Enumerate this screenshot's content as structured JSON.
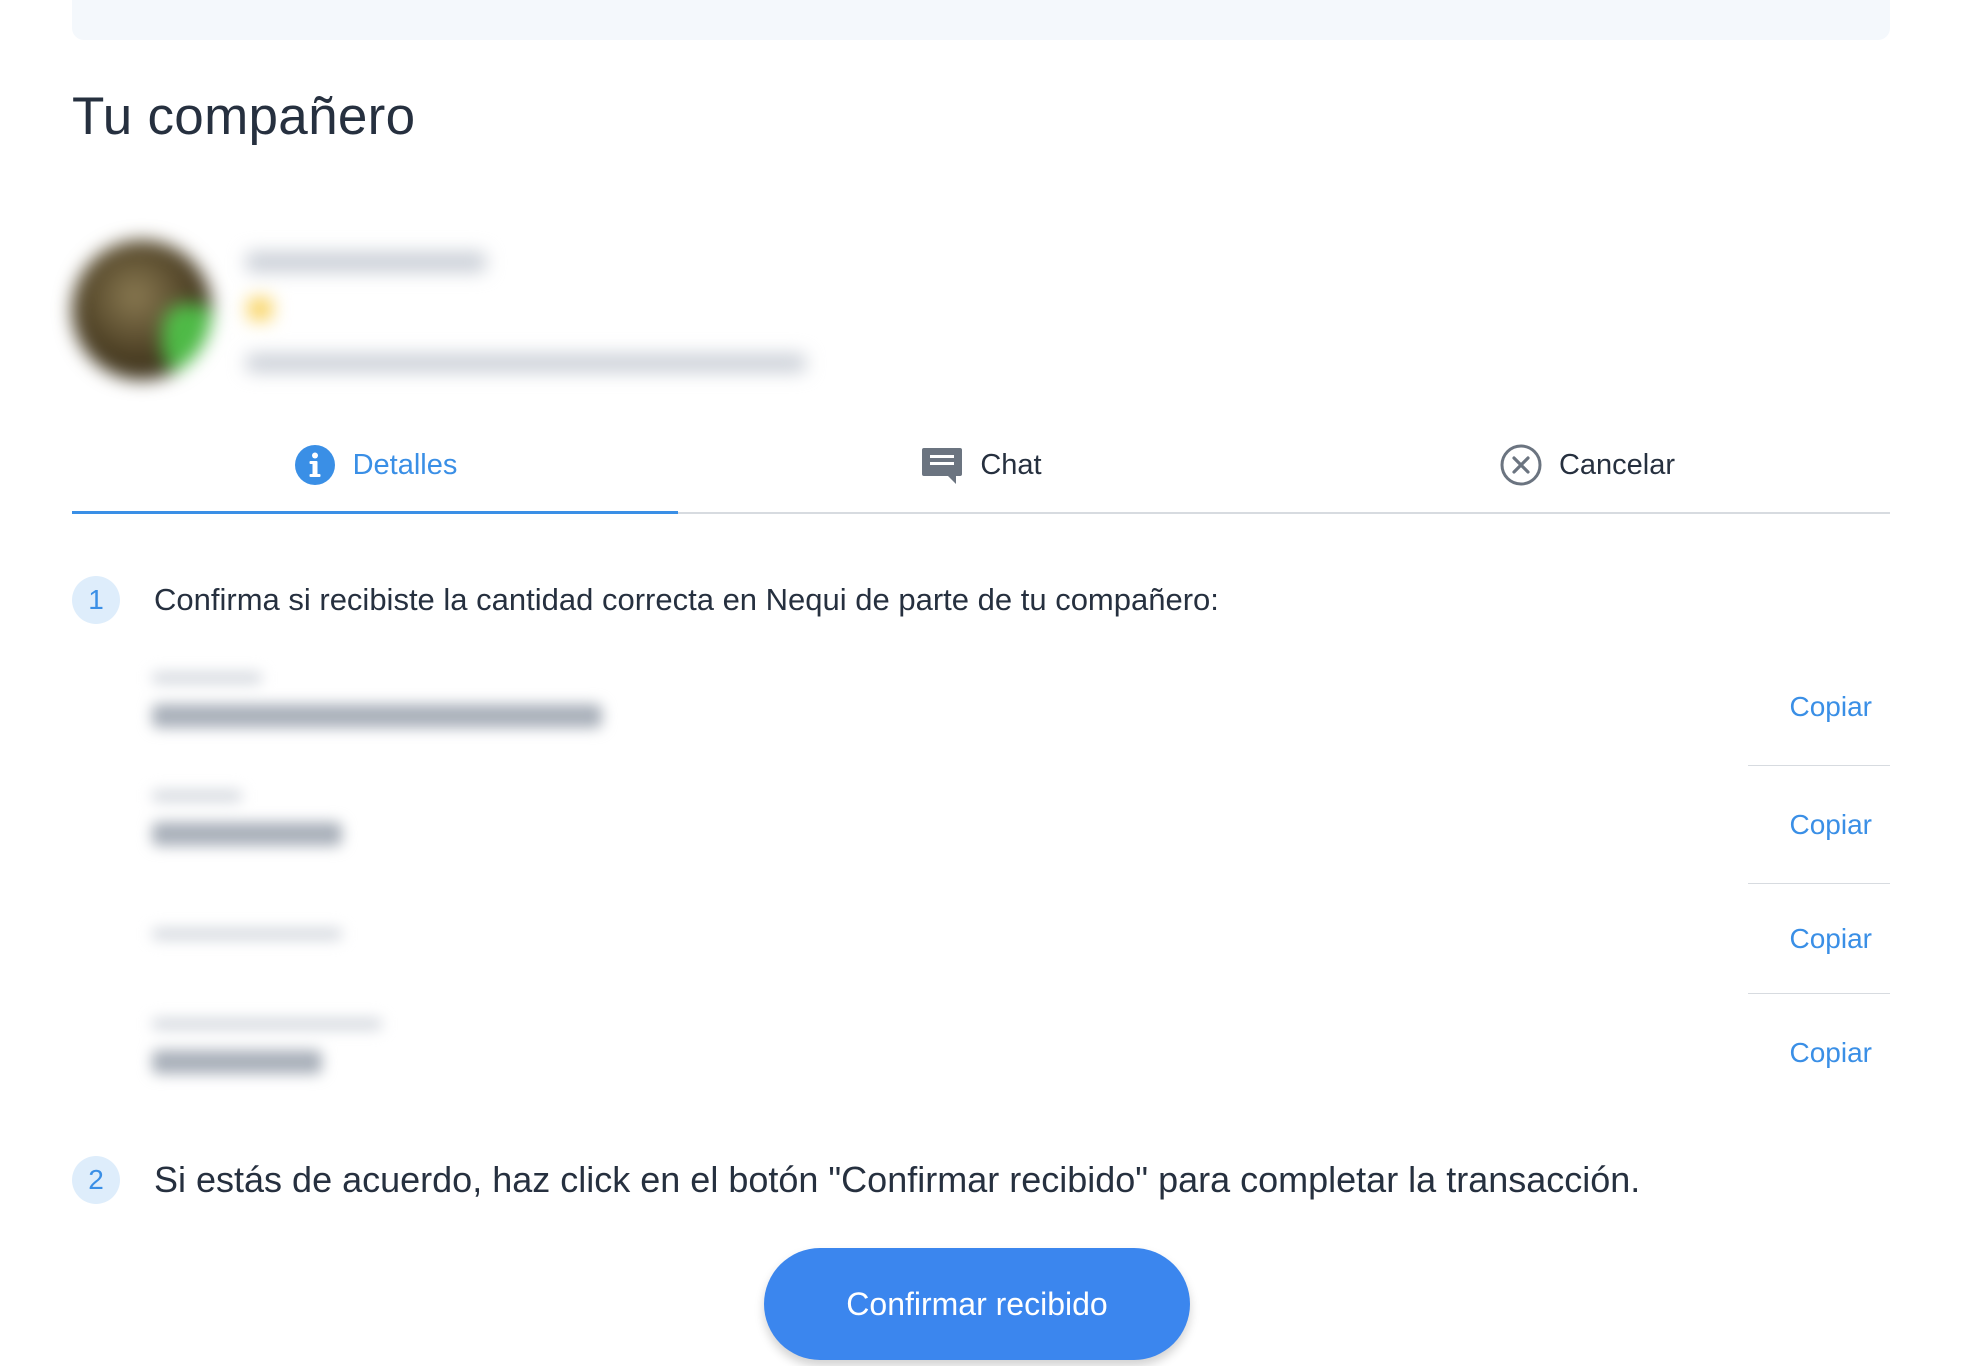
{
  "header": {
    "title": "Tu compañero"
  },
  "tabs": [
    {
      "label": "Detalles",
      "icon": "info-icon",
      "active": true
    },
    {
      "label": "Chat",
      "icon": "chat-icon",
      "active": false
    },
    {
      "label": "Cancelar",
      "icon": "close-circle-icon",
      "active": false
    }
  ],
  "steps": [
    {
      "number": "1",
      "text": "Confirma si recibiste la cantidad correcta en Nequi de parte de tu compañero:"
    },
    {
      "number": "2",
      "text": "Si estás de acuerdo, haz click en el botón \"Confirmar recibido\" para completar la transacción."
    }
  ],
  "details": [
    {
      "copy_label": "Copiar"
    },
    {
      "copy_label": "Copiar"
    },
    {
      "copy_label": "Copiar"
    },
    {
      "copy_label": "Copiar"
    }
  ],
  "confirm_button": {
    "label": "Confirmar recibido"
  },
  "colors": {
    "accent": "#3a8fe6",
    "button": "#3b86ee",
    "text": "#26303f",
    "divider": "#d7dbe0"
  }
}
